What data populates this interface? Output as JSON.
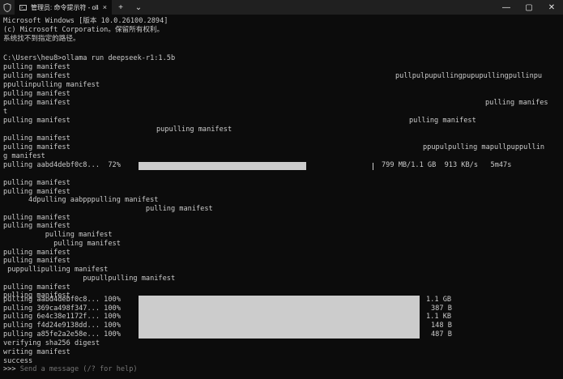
{
  "titlebar": {
    "tab_title": "管理员: 命令提示符 - ollama r",
    "app_icon": "shield-icon",
    "tab_icon": "terminal-icon",
    "close_tab": "×",
    "new_tab": "+",
    "dropdown": "⌄",
    "minimize": "—",
    "maximize": "▢",
    "close": "✕"
  },
  "console": {
    "header": [
      "Microsoft Windows [版本 10.0.26100.2894]",
      "(c) Microsoft Corporation。保留所有权利。",
      "系统找不到指定的路径。"
    ],
    "command": "C:\\Users\\heu8>ollama run deepseek-r1:1.5b",
    "block1": [
      "pulling manifest",
      "pulling manifest",
      "ppullinpulling manifest",
      "pulling manifest",
      "pulling manifest",
      "t",
      "pulling manifest",
      "pulling manifest",
      "pulling manifest",
      "g manifest"
    ],
    "block1_right": {
      "r1": "pullpulpupullingpupupullingpullinpu",
      "r4": "pulling manifes",
      "r6": "pulling manifest",
      "r7": "pupulling manifest",
      "r9": "ppupulpulling mapullpuppullin"
    },
    "progress": {
      "label": "pulling aabd4debf0c8...  72%",
      "percent": 72,
      "stats": "799 MB/1.1 GB  913 KB/s   5m47s"
    },
    "block2": [
      "pulling manifest",
      "pulling manifest",
      "      4dpulling aabpppulling manifest",
      "                                  pulling manifest",
      "pulling manifest",
      "pulling manifest",
      "          pulling manifest",
      "            pulling manifest",
      "pulling manifest",
      "pulling manifest",
      " puppullipulling manifest",
      "                   pupullpulling manifest",
      "pulling manifest",
      "pulling manifest"
    ],
    "layers": [
      {
        "label": "pulling aabd4debf0c8... 100%",
        "size": "1.1 GB"
      },
      {
        "label": "pulling 369ca498f347... 100%",
        "size": "387 B"
      },
      {
        "label": "pulling 6e4c38e1172f... 100%",
        "size": "1.1 KB"
      },
      {
        "label": "pulling f4d24e9138dd... 100%",
        "size": "148 B"
      },
      {
        "label": "pulling a85fe2a2e58e... 100%",
        "size": "487 B"
      }
    ],
    "tail": [
      "verifying sha256 digest",
      "writing manifest",
      "success"
    ],
    "prompt": {
      "prefix": ">>> ",
      "placeholder": "Send a message (/? for help)"
    }
  }
}
